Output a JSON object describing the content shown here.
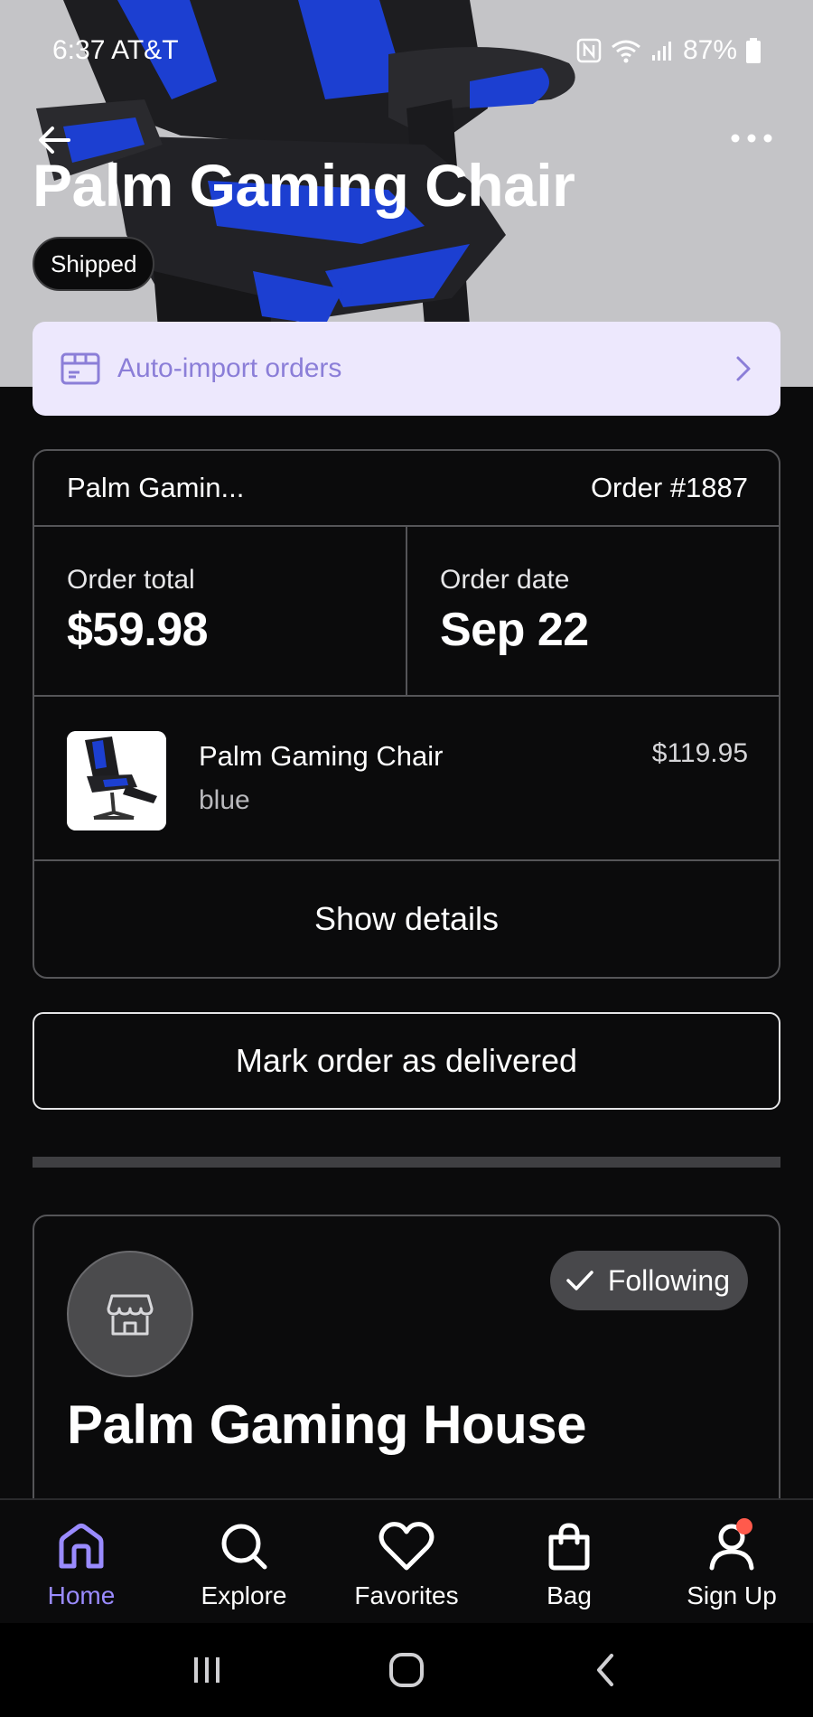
{
  "status_bar": {
    "time": "6:37",
    "carrier": "AT&T",
    "battery": "87%"
  },
  "header": {
    "title": "Palm Gaming Chair",
    "status_badge": "Shipped"
  },
  "auto_import": {
    "label": "Auto-import orders"
  },
  "order": {
    "store_short": "Palm Gamin...",
    "number": "Order #1887",
    "total_label": "Order total",
    "total_value": "$59.98",
    "date_label": "Order date",
    "date_value": "Sep 22",
    "item": {
      "name": "Palm Gaming Chair",
      "variant": "blue",
      "price": "$119.95"
    },
    "show_details": "Show details"
  },
  "mark_delivered": "Mark order as delivered",
  "store": {
    "following_label": "Following",
    "name": "Palm Gaming House"
  },
  "nav": {
    "items": [
      {
        "label": "Home",
        "icon": "home-icon"
      },
      {
        "label": "Explore",
        "icon": "search-icon"
      },
      {
        "label": "Favorites",
        "icon": "heart-icon"
      },
      {
        "label": "Bag",
        "icon": "bag-icon"
      },
      {
        "label": "Sign Up",
        "icon": "user-icon"
      }
    ]
  },
  "colors": {
    "accent": "#9a8bff",
    "banner_bg": "#ede8fd",
    "banner_text": "#8b7ed8",
    "chair_blue": "#1c3fd1",
    "notification": "#ff5a4c"
  }
}
